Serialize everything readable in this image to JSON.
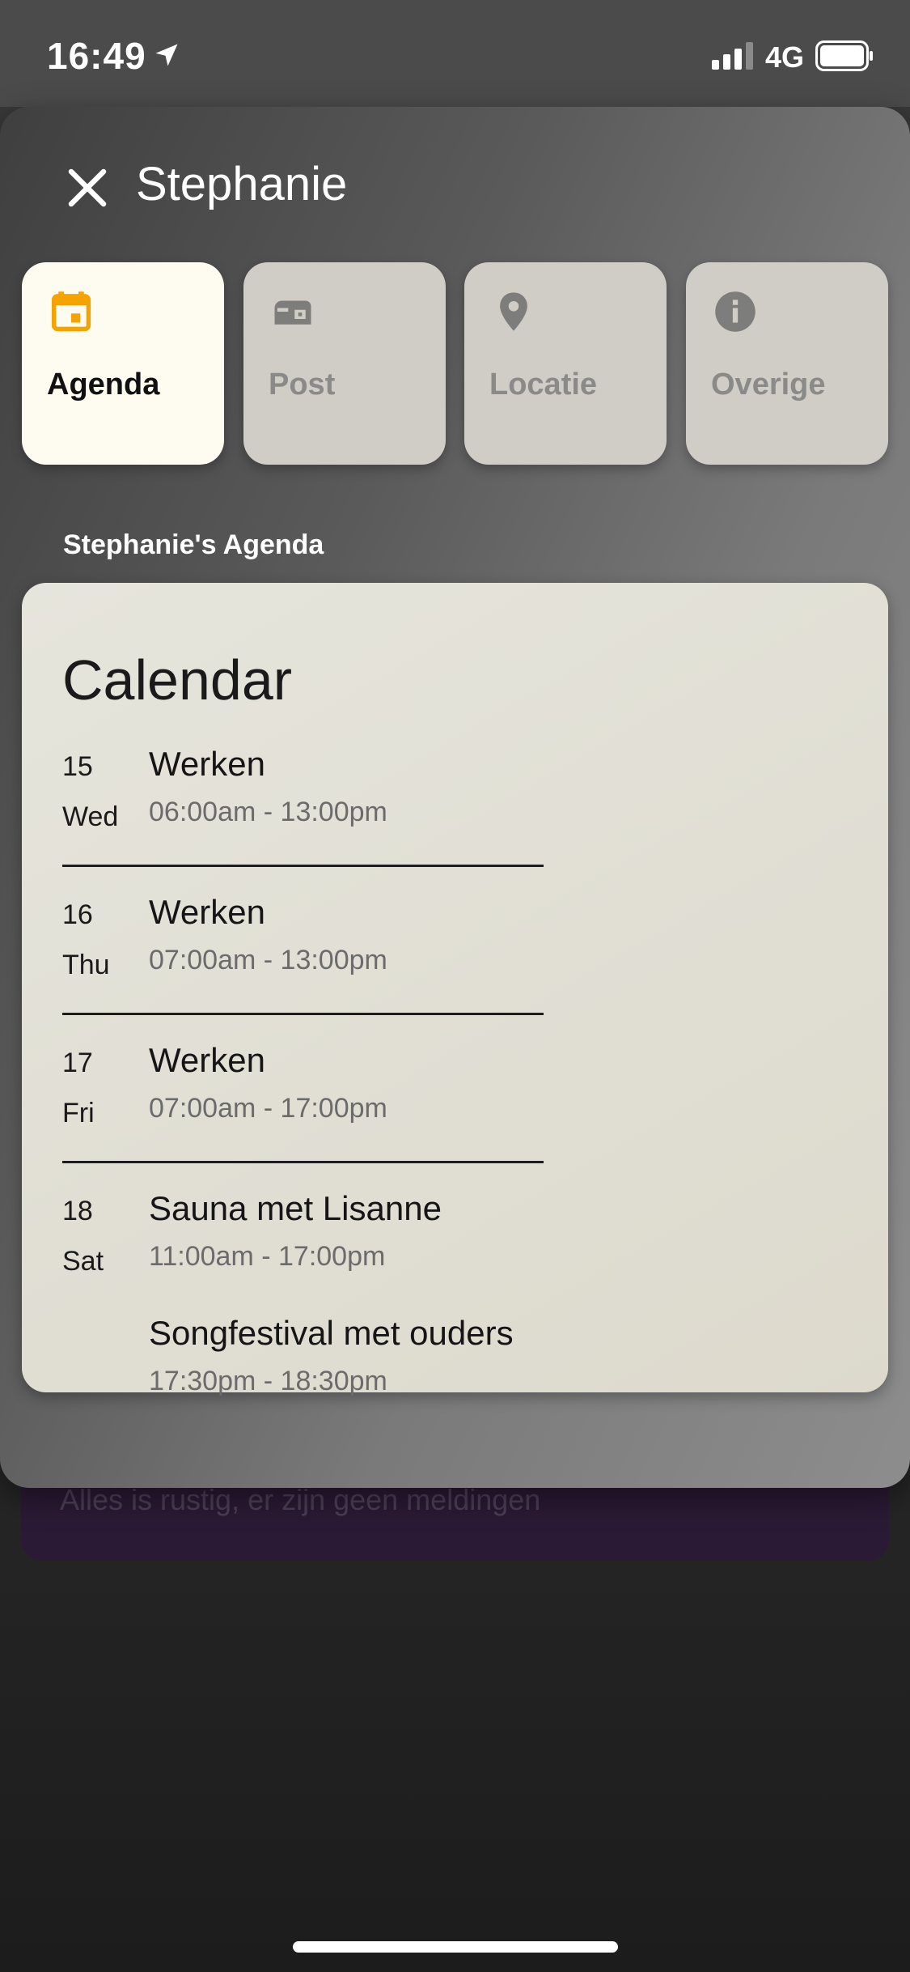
{
  "status_bar": {
    "time": "16:49",
    "network": "4G"
  },
  "background_notice": {
    "text": "Alles is rustig, er zijn geen meldingen"
  },
  "sheet": {
    "title": "Stephanie",
    "tabs": [
      {
        "label": "Agenda",
        "icon": "calendar-icon",
        "active": true
      },
      {
        "label": "Post",
        "icon": "mailbox-icon",
        "active": false
      },
      {
        "label": "Locatie",
        "icon": "location-pin-icon",
        "active": false
      },
      {
        "label": "Overige",
        "icon": "info-icon",
        "active": false
      }
    ],
    "section_title": "Stephanie's Agenda"
  },
  "colors": {
    "agenda_icon": "#f5a300",
    "inactive_icon": "#7d7d7b",
    "active_tab_bg": "#fefcf1",
    "inactive_tab_bg": "#cfcdc6"
  },
  "calendar": {
    "title": "Calendar",
    "days": [
      {
        "num": "15",
        "name": "Wed",
        "events": [
          {
            "title": "Werken",
            "time": "06:00am - 13:00pm"
          }
        ]
      },
      {
        "num": "16",
        "name": "Thu",
        "events": [
          {
            "title": "Werken",
            "time": "07:00am - 13:00pm"
          }
        ]
      },
      {
        "num": "17",
        "name": "Fri",
        "events": [
          {
            "title": "Werken",
            "time": "07:00am - 17:00pm"
          }
        ]
      },
      {
        "num": "18",
        "name": "Sat",
        "events": [
          {
            "title": "Sauna met Lisanne",
            "time": "11:00am - 17:00pm"
          },
          {
            "title": "Songfestival met ouders",
            "time": "17:30pm - 18:30pm"
          }
        ]
      }
    ]
  }
}
